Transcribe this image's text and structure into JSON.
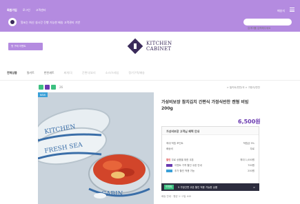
{
  "topbar": {
    "links": [
      "회원가입",
      "로그인",
      "고객센터"
    ],
    "right_link": "배송지",
    "notice": "알씨는 최신 실시간 진행 가능한 배송",
    "notice2": "고객관리 기반",
    "search_placeholder": "검색어를 입력해주세요"
  },
  "brand": {
    "promo_label": "첫 구매 이벤트",
    "logo_line1": "KITCHEN",
    "logo_line2": "CABINET"
  },
  "nav": {
    "items": [
      "전체상품",
      "밀키트",
      "반찬세트",
      "찌개/국",
      "간편식/요리",
      "소스/드레싱",
      "정기구독/배송"
    ]
  },
  "product": {
    "count": "26",
    "breadcrumb": "> 밀키트/반찬/국 > 가정식/반찬",
    "corner_tag": "NEW",
    "title": "가성비보장 참치김치 간편식 가정식반찬 캔형 비빔 200g",
    "price": "6,500원",
    "info": {
      "header": "가성비보장 고객님 혜택 안내",
      "rows": [
        {
          "label": "최대 적립 포인트",
          "value": "적립금 5%"
        },
        {
          "label": "배송비",
          "value": "무료"
        },
        {
          "label": "무료 상품을 위한 쿠폰",
          "value": "최대 1,000원"
        },
        {
          "label": "이벤트 가격 할인 쿠폰 안내",
          "value": "700원"
        },
        {
          "label": "추가 할인 적용 가능",
          "value": "200원"
        }
      ],
      "red_label": "할인"
    },
    "promo_bar": {
      "label": "이벤트",
      "text": "5 가정간편 쿠폰 할인 적용 가능한 상품",
      "chevron": ">"
    },
    "footnote": "배송 안내 · 평균 1~2일 소요"
  },
  "colors": {
    "accent": "#b48be0",
    "brand": "#3a2a5a",
    "price": "#6a3ab0",
    "green": "#3cc080"
  }
}
